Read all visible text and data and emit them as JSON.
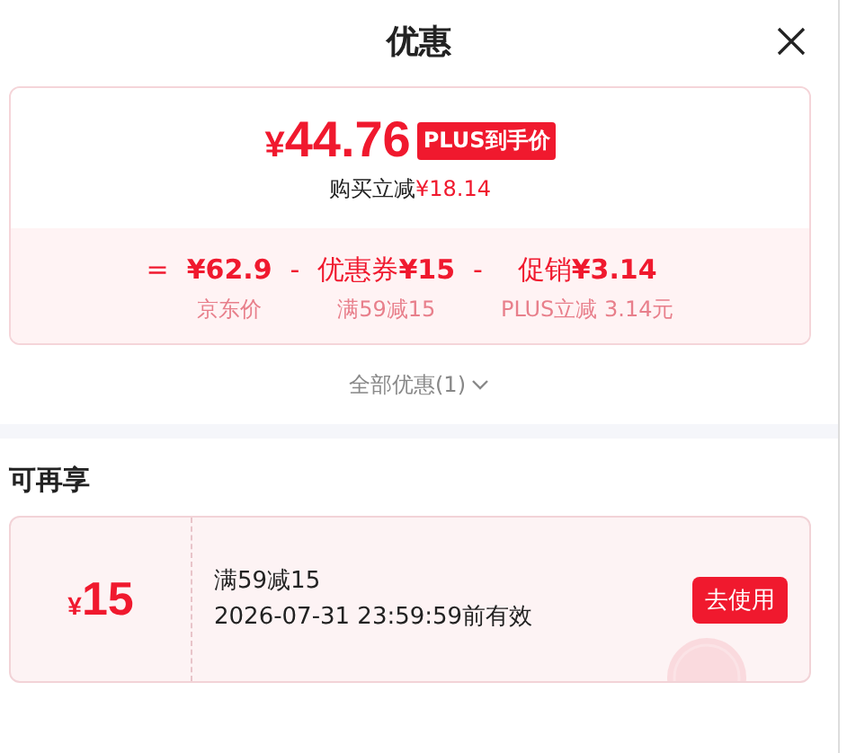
{
  "header": {
    "title": "优惠"
  },
  "summary": {
    "price_symbol": "¥",
    "price": "44.76",
    "badge": "PLUS到手价",
    "saving_label": "购买立减",
    "saving": "¥18.14",
    "breakdown": [
      {
        "operator": "=",
        "value": "¥62.9",
        "note": "京东价"
      },
      {
        "operator": "-",
        "label": "优惠券",
        "value": "¥15",
        "note": "满59减15"
      },
      {
        "operator": "-",
        "label": "促销",
        "value": "¥3.14",
        "note": "PLUS立减 3.14元"
      }
    ]
  },
  "all_offers": "全部优惠(1)",
  "coupons_section": {
    "title": "可再享",
    "coupons": [
      {
        "symbol": "¥",
        "amount": "15",
        "condition": "满59减15",
        "validity": "2026-07-31 23:59:59前有效",
        "button": "去使用",
        "received": true
      }
    ]
  }
}
